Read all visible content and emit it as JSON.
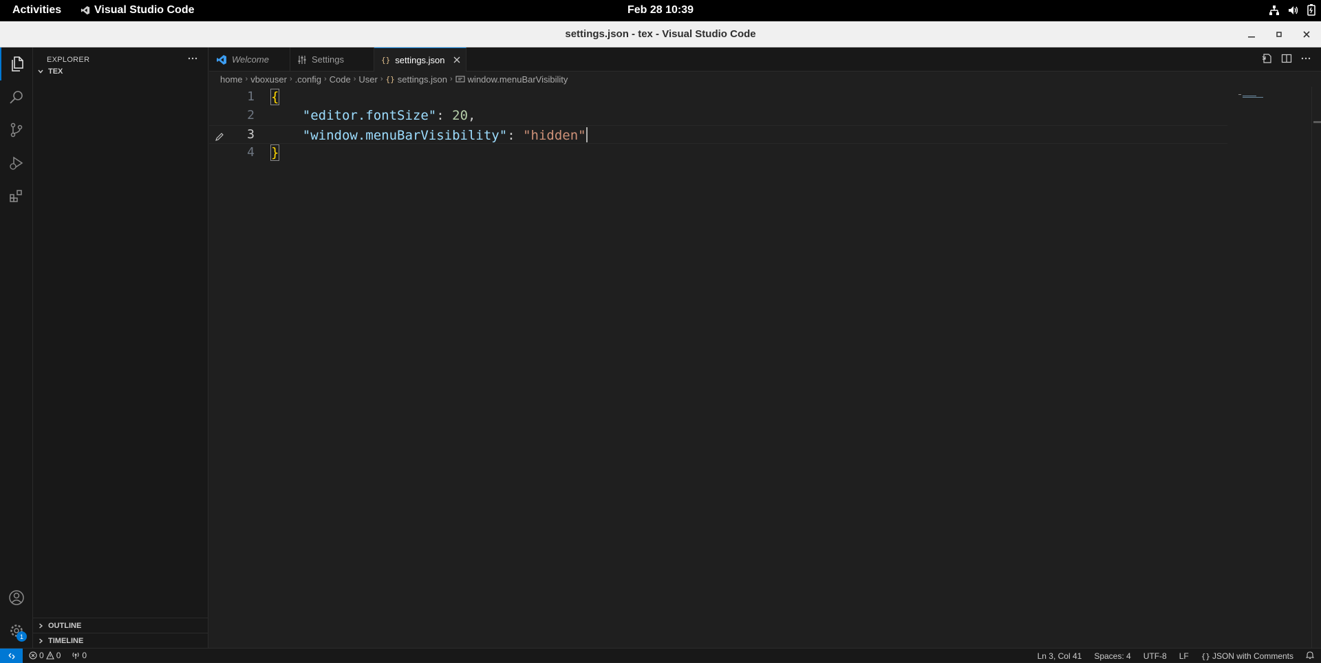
{
  "system": {
    "activities": "Activities",
    "app_name": "Visual Studio Code",
    "clock": "Feb 28  10:39"
  },
  "window": {
    "title": "settings.json - tex - Visual Studio Code"
  },
  "sidebar": {
    "title": "EXPLORER",
    "folder": "TEX",
    "outline": "OUTLINE",
    "timeline": "TIMELINE"
  },
  "activity": {
    "accounts_badge": "1"
  },
  "tabs": [
    {
      "label": "Welcome"
    },
    {
      "label": "Settings"
    },
    {
      "label": "settings.json"
    }
  ],
  "breadcrumb": {
    "items": [
      "home",
      "vboxuser",
      ".config",
      "Code",
      "User",
      "settings.json",
      "window.menuBarVisibility"
    ],
    "file_icon": "{}"
  },
  "editor": {
    "lines": [
      {
        "number": "1",
        "open": "{"
      },
      {
        "number": "2",
        "key": "\"editor.fontSize\"",
        "colon": ": ",
        "value": "20",
        "trail": ","
      },
      {
        "number": "3",
        "key": "\"window.menuBarVisibility\"",
        "colon": ": ",
        "value": "\"hidden\""
      },
      {
        "number": "4",
        "close": "}"
      }
    ]
  },
  "status": {
    "errors": "0",
    "warnings": "0",
    "ports": "0",
    "position": "Ln 3, Col 41",
    "spaces": "Spaces: 4",
    "encoding": "UTF-8",
    "eol": "LF",
    "language": "JSON with Comments"
  },
  "colors": {
    "accent": "#0078d4",
    "key": "#9cdcfe",
    "string": "#ce9178",
    "number": "#b5cea8",
    "brace": "#ffd700"
  }
}
